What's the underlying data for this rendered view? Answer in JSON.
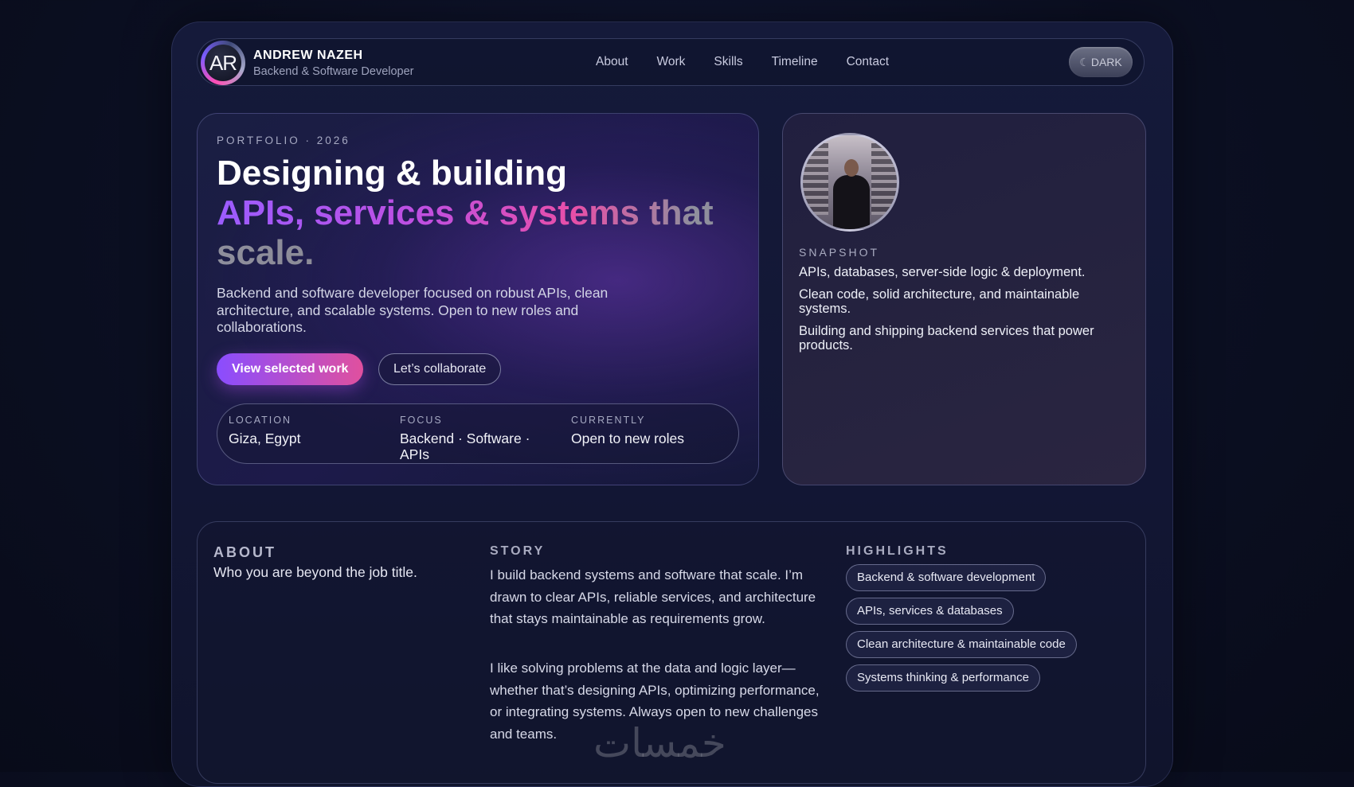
{
  "header": {
    "logo_text": "AR",
    "name": "ANDREW NAZEH",
    "role": "Backend & Software Developer",
    "nav": [
      "About",
      "Work",
      "Skills",
      "Timeline",
      "Contact"
    ],
    "theme_toggle": "DARK"
  },
  "hero": {
    "eyebrow": "PORTFOLIO · 2026",
    "headline_line1": "Designing & building",
    "headline_line2": "APIs, services & systems that scale.",
    "intro": "Backend and software developer focused on robust APIs, clean architecture, and scalable systems. Open to new roles and collaborations.",
    "primary_button": "View selected work",
    "secondary_button": "Let’s collaborate",
    "facts": [
      {
        "label": "LOCATION",
        "value": "Giza, Egypt"
      },
      {
        "label": "FOCUS",
        "value": "Backend · Software · APIs"
      },
      {
        "label": "CURRENTLY",
        "value": "Open to new roles"
      }
    ]
  },
  "snapshot": {
    "label": "SNAPSHOT",
    "items": [
      "APIs, databases, server-side logic & deployment.",
      "Clean code, solid architecture, and maintainable systems.",
      "Building and shipping backend services that power products."
    ]
  },
  "about": {
    "title": "ABOUT",
    "subtitle": "Who you are beyond the job title.",
    "story_title": "STORY",
    "story_p1": "I build backend systems and software that scale. I’m drawn to clear APIs, reliable services, and architecture that stays maintainable as requirements grow.",
    "story_p2": "I like solving problems at the data and logic layer—whether that’s designing APIs, optimizing performance, or integrating systems. Always open to new challenges and teams.",
    "highlights_title": "HIGHLIGHTS",
    "highlights": [
      "Backend & software development",
      "APIs, services & databases",
      "Clean architecture & maintainable code",
      "Systems thinking & performance"
    ]
  },
  "watermark": "خمسات",
  "colors": {
    "accent_purple": "#8a4dff",
    "accent_pink": "#e0509e",
    "background": "#0b0f22"
  }
}
